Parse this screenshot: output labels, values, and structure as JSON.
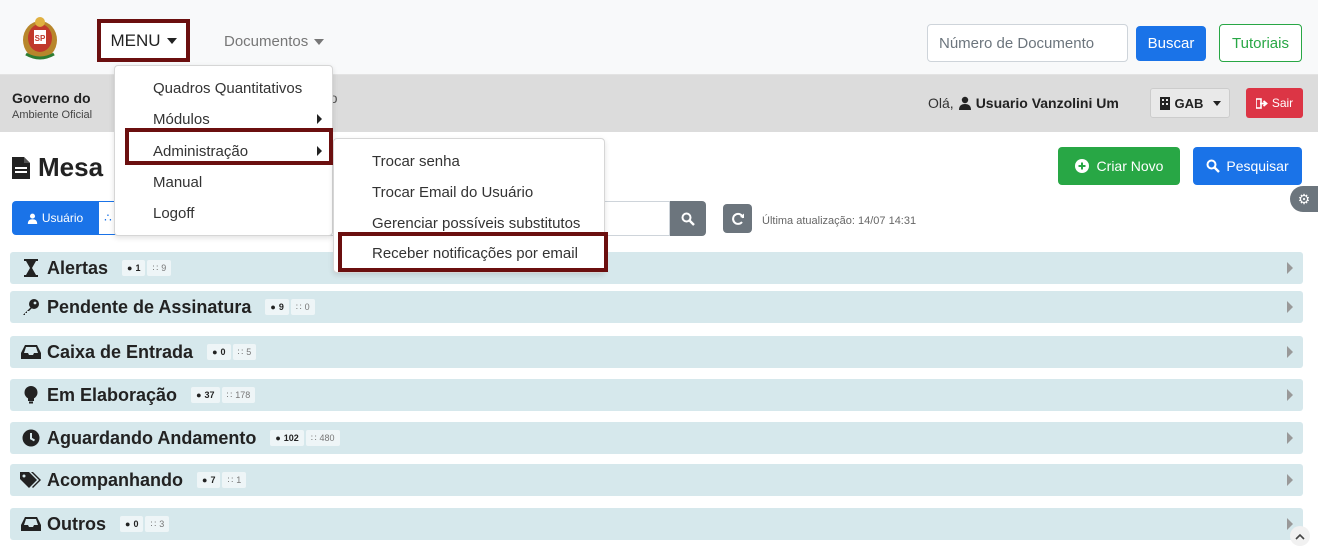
{
  "topbar": {
    "menu_label": "MENU",
    "documentos_label": "Documentos",
    "search_placeholder": "Número de Documento",
    "buscar_label": "Buscar",
    "tutoriais_label": "Tutoriais"
  },
  "subbar": {
    "org_name": "Governo do",
    "org_env": "Ambiente Oficial",
    "org_suffix": "rio",
    "greeting_prefix": "Olá,",
    "user_name": "Usuario Vanzolini Um",
    "lotacao": "GAB",
    "sair_label": "Sair"
  },
  "page": {
    "title": "Mesa",
    "criar_label": "Criar Novo",
    "pesquisar_label": "Pesquisar",
    "usuario_toggle": "Usuário",
    "last_update": "Última atualização: 14/07 14:31"
  },
  "menu": {
    "items": [
      {
        "label": "Quadros Quantitativos"
      },
      {
        "label": "Módulos"
      },
      {
        "label": "Administração"
      },
      {
        "label": "Manual"
      },
      {
        "label": "Logoff"
      }
    ]
  },
  "admin_menu": {
    "items": [
      {
        "label": "Trocar senha"
      },
      {
        "label": "Trocar Email do Usuário"
      },
      {
        "label": "Gerenciar possíveis substitutos"
      },
      {
        "label": "Receber notificações por email"
      }
    ]
  },
  "groups": [
    {
      "name": "Alertas",
      "icon": "hourglass-icon",
      "user_count": "1",
      "lot_count": "9"
    },
    {
      "name": "Pendente de Assinatura",
      "icon": "key-icon",
      "user_count": "9",
      "lot_count": "0"
    },
    {
      "name": "Caixa de Entrada",
      "icon": "inbox-icon",
      "user_count": "0",
      "lot_count": "5"
    },
    {
      "name": "Em Elaboração",
      "icon": "lightbulb-icon",
      "user_count": "37",
      "lot_count": "178"
    },
    {
      "name": "Aguardando Andamento",
      "icon": "clock-icon",
      "user_count": "102",
      "lot_count": "480"
    },
    {
      "name": "Acompanhando",
      "icon": "tags-icon",
      "user_count": "7",
      "lot_count": "1"
    },
    {
      "name": "Outros",
      "icon": "inbox-icon",
      "user_count": "0",
      "lot_count": "3"
    }
  ]
}
